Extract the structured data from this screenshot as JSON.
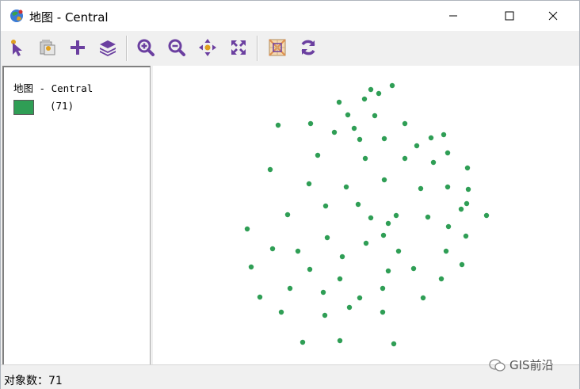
{
  "window": {
    "title": "地图 - Central",
    "controls": {
      "minimize": "minimize",
      "maximize": "maximize",
      "close": "close"
    }
  },
  "toolbar": {
    "buttons": [
      {
        "name": "select-tool",
        "icon": "pointer-arrow-icon"
      },
      {
        "name": "info-tool",
        "icon": "identify-icon"
      },
      {
        "name": "add-layer",
        "icon": "plus-icon"
      },
      {
        "name": "layers",
        "icon": "layers-icon"
      },
      {
        "name": "zoom-in",
        "icon": "zoom-in-icon"
      },
      {
        "name": "zoom-out",
        "icon": "zoom-out-icon"
      },
      {
        "name": "pan",
        "icon": "pan-arrows-icon"
      },
      {
        "name": "full-extent",
        "icon": "full-extent-icon"
      },
      {
        "name": "map-view",
        "icon": "map-icon"
      },
      {
        "name": "refresh",
        "icon": "refresh-icon"
      }
    ],
    "icon_color": "#6b3fa0"
  },
  "legend": {
    "title": "地图 - Central",
    "layer_count": "(71)",
    "swatch_color": "#2f9e55"
  },
  "status": {
    "text": "对象数：71"
  },
  "watermark": {
    "text": "GIS前沿"
  },
  "map": {
    "point_color": "#2f9e55",
    "point_count": 71
  }
}
